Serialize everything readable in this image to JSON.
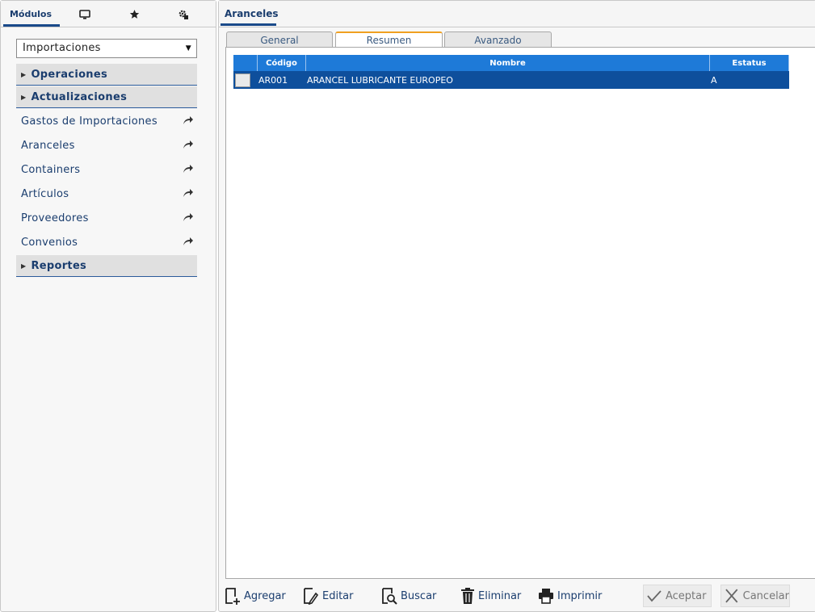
{
  "left_tabs": {
    "modulos_label": "Módulos",
    "icons": [
      "monitor-icon",
      "star-icon",
      "settings-icon"
    ]
  },
  "module_select": {
    "value": "Importaciones"
  },
  "sidebar": {
    "sections": [
      {
        "label": "Operaciones"
      },
      {
        "label": "Actualizaciones"
      },
      {
        "label": "Reportes"
      }
    ],
    "items": [
      {
        "label": "Gastos de Importaciones"
      },
      {
        "label": "Aranceles"
      },
      {
        "label": "Containers"
      },
      {
        "label": "Artículos"
      },
      {
        "label": "Proveedores"
      },
      {
        "label": "Convenios"
      }
    ]
  },
  "right": {
    "title": "Aranceles",
    "tabs": [
      {
        "label": "General"
      },
      {
        "label": "Resumen",
        "active": true
      },
      {
        "label": "Avanzado"
      }
    ]
  },
  "grid": {
    "columns": [
      "Código",
      "Nombre",
      "Estatus"
    ],
    "rows": [
      {
        "codigo": "AR001",
        "nombre": "ARANCEL LUBRICANTE EUROPEO",
        "estatus": "A",
        "selected": true
      }
    ]
  },
  "toolbar": {
    "agregar": "Agregar",
    "editar": "Editar",
    "buscar": "Buscar",
    "eliminar": "Eliminar",
    "imprimir": "Imprimir",
    "aceptar": "Aceptar",
    "cancelar": "Cancelar"
  },
  "colors": {
    "accent": "#1a3d6e",
    "grid_header": "#1e7ad8",
    "selected_row": "#0e4f9c",
    "active_tab_border": "#f0a020"
  }
}
